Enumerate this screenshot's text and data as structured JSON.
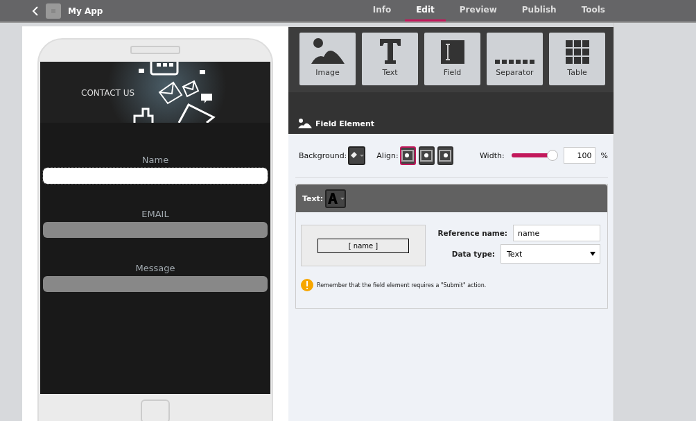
{
  "app_bar": {
    "title": "My App"
  },
  "nav_tabs": [
    {
      "label": "Info",
      "selected": false
    },
    {
      "label": "Edit",
      "selected": true
    },
    {
      "label": "Preview",
      "selected": false
    },
    {
      "label": "Publish",
      "selected": false
    },
    {
      "label": "Tools",
      "selected": false
    }
  ],
  "phone": {
    "banner": {
      "text": "CONTACT US"
    },
    "form_fields": [
      {
        "label": "Name",
        "selected": true
      },
      {
        "label": "EMAIL",
        "selected": false
      },
      {
        "label": "Message",
        "selected": false
      }
    ]
  },
  "element_palette": [
    {
      "kind": "image",
      "label": "Image"
    },
    {
      "kind": "text",
      "label": "Text"
    },
    {
      "kind": "field",
      "label": "Field"
    },
    {
      "kind": "separator",
      "label": "Separator"
    },
    {
      "kind": "table",
      "label": "Table"
    }
  ],
  "properties": {
    "title": "Field Element",
    "background_label": "Background:",
    "align_label": "Align:",
    "align_options": [
      {
        "kind": "left",
        "selected": true
      },
      {
        "kind": "center",
        "selected": false
      },
      {
        "kind": "right",
        "selected": false
      }
    ],
    "width_label": "Width:",
    "width": {
      "level": 1,
      "value": "100",
      "unit": "%"
    },
    "text_section": {
      "label": "Text:",
      "preview": "[ name ]",
      "reference_name_label": "Reference name:",
      "reference_name": "name",
      "data_type_label": "Data type:",
      "data_type": "Text",
      "warning": "Remember that the field element requires a \"Submit\" action."
    }
  }
}
